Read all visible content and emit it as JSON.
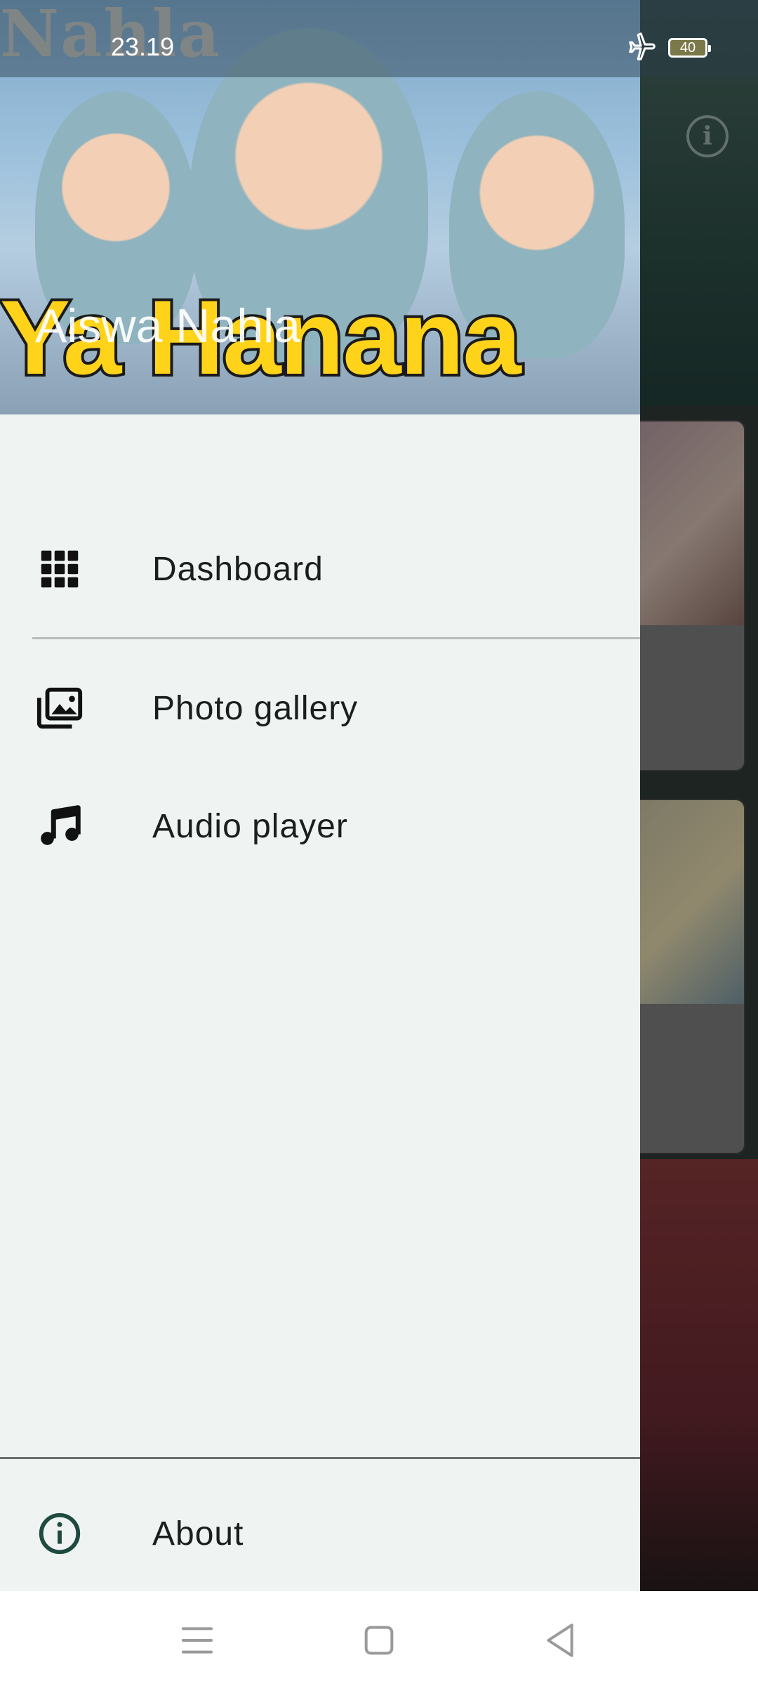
{
  "status_bar": {
    "time": "23.19",
    "battery": "40",
    "icons": [
      "airplane-mode-icon",
      "battery-icon"
    ]
  },
  "drawer": {
    "header": {
      "title": "Aiswa Nahla",
      "banner_brand_text": "Nahla",
      "banner_text": "Ya Hanana"
    },
    "items": [
      {
        "label": "Dashboard",
        "icon": "grid-icon"
      },
      {
        "label": "Photo gallery",
        "icon": "photo-library-icon"
      },
      {
        "label": "Audio player",
        "icon": "music-note-icon"
      }
    ],
    "footer": {
      "label": "About",
      "icon": "info-icon"
    }
  },
  "nav_bar": {
    "buttons": [
      "menu-nav-icon",
      "home-nav-icon",
      "back-nav-icon"
    ]
  },
  "colors": {
    "drawer_bg": "#eff4f2",
    "banner_yellow": "#ffd31a",
    "about_icon": "#1f4a3f"
  }
}
